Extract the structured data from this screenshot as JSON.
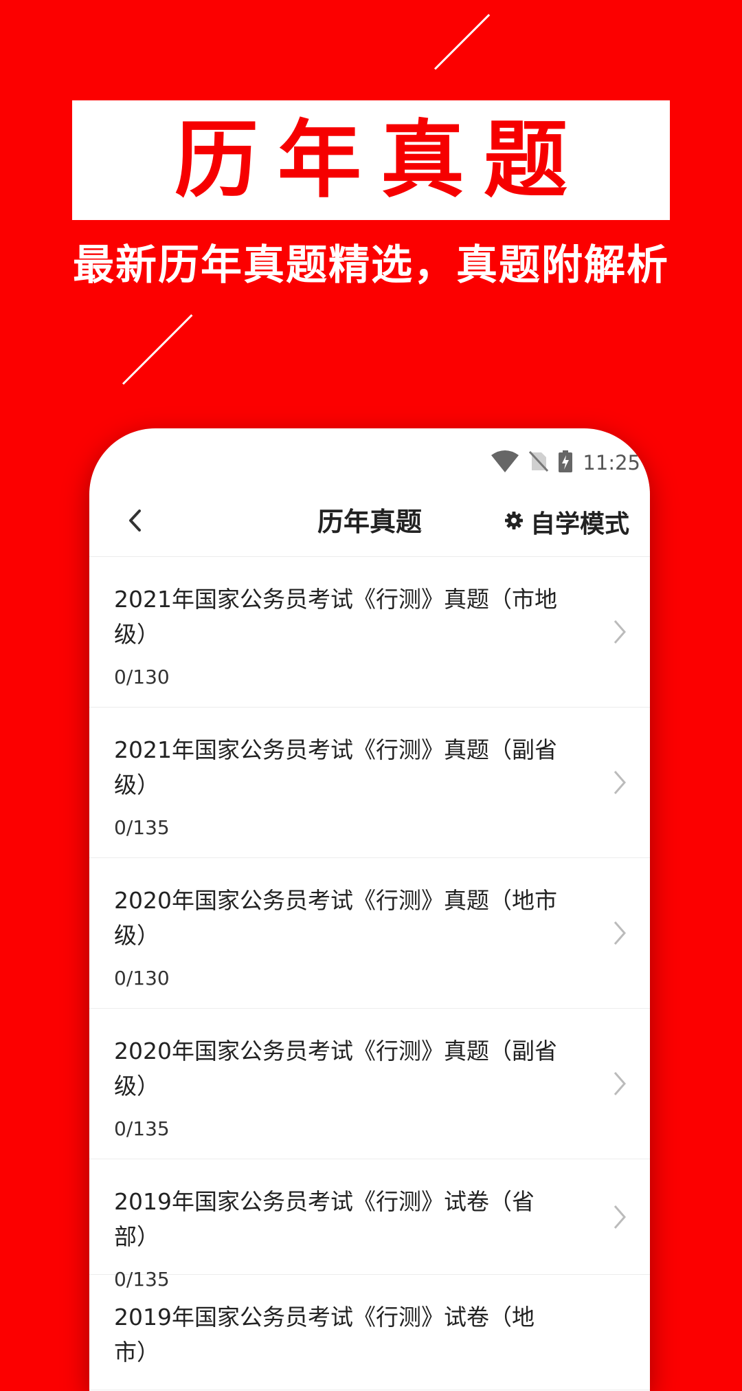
{
  "banner": {
    "title": "历年真题",
    "subtitle": "最新历年真题精选，真题附解析"
  },
  "status_bar": {
    "time": "11:25",
    "icons": [
      "wifi-icon",
      "no-sim-icon",
      "battery-charging-icon"
    ]
  },
  "app_bar": {
    "title": "历年真题",
    "back_icon": "chevron-left-icon",
    "mode_icon": "gear-icon",
    "mode_label": "自学模式"
  },
  "exam_list": [
    {
      "title": "2021年国家公务员考试《行测》真题（市地级）",
      "progress": "0/130"
    },
    {
      "title": "2021年国家公务员考试《行测》真题（副省级）",
      "progress": "0/135"
    },
    {
      "title": "2020年国家公务员考试《行测》真题（地市级）",
      "progress": "0/130"
    },
    {
      "title": "2020年国家公务员考试《行测》真题（副省级）",
      "progress": "0/135"
    },
    {
      "title": "2019年国家公务员考试《行测》试卷（省部）",
      "progress": "0/135"
    },
    {
      "title": "2019年国家公务员考试《行测》试卷（地市）",
      "progress": ""
    }
  ],
  "colors": {
    "brand_red": "#fc0000",
    "hero_text_red": "#f60000",
    "chevron_gray": "#bbbbbb"
  }
}
